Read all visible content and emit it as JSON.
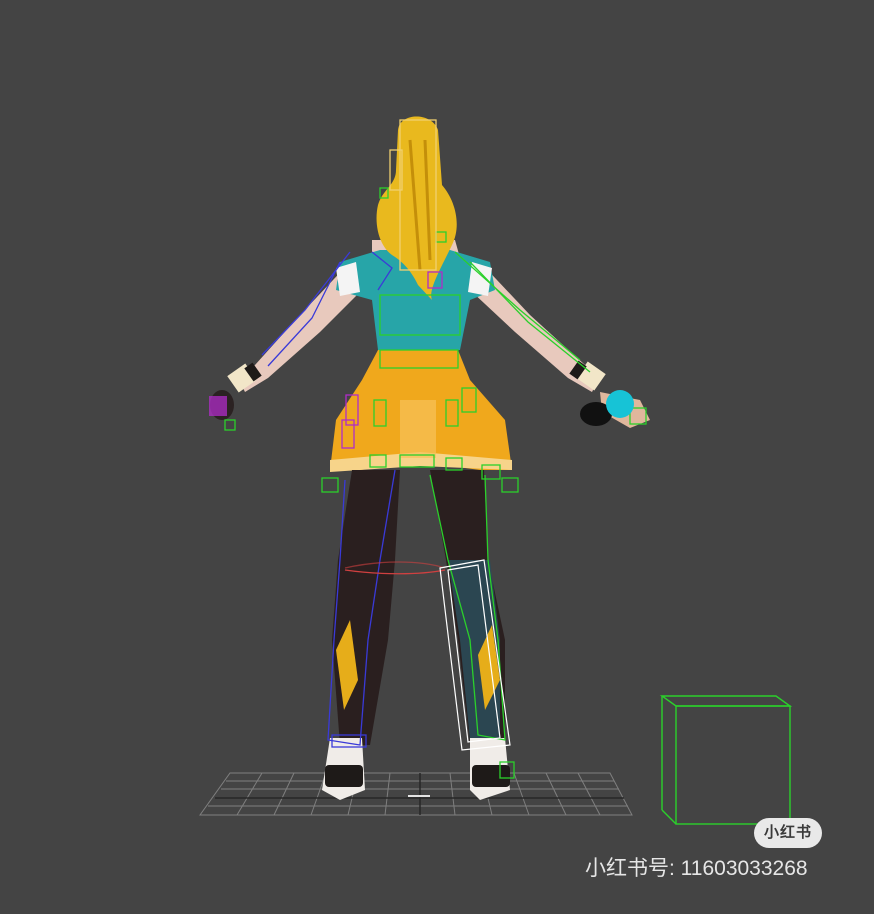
{
  "viewport": {
    "background": "#444444",
    "colors": {
      "hair": "#e9b91e",
      "top": "#27a5a8",
      "skirt": "#f0a81c",
      "legs": "#2a1f1f",
      "skin": "#e8c9bd",
      "rig_green": "#2bd02b",
      "rig_blue": "#3a3ad8",
      "rig_purple": "#b02cc8",
      "cyan_handle": "#17c3d6",
      "grid": "#8a8a8a"
    },
    "icons": [
      "character-model-icon",
      "ground-grid-icon",
      "helper-cube-icon"
    ]
  },
  "watermark": {
    "logo_text": "小红书",
    "id_text": "小红书号: 11603033268"
  }
}
